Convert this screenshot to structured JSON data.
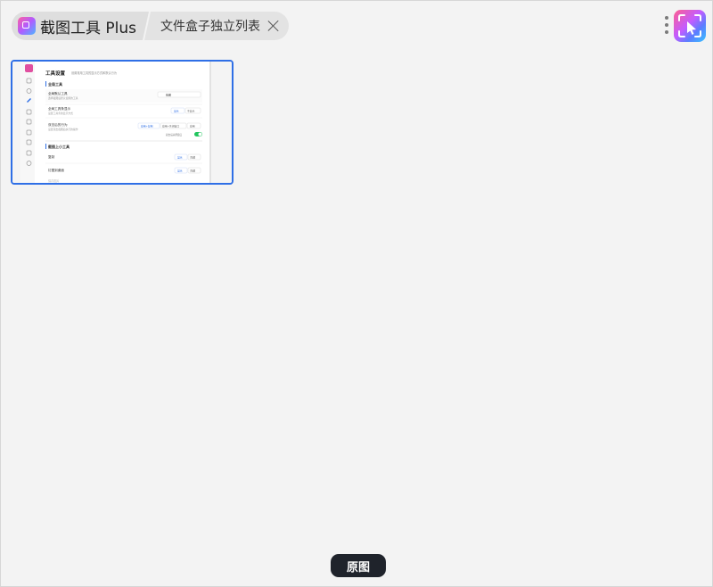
{
  "header": {
    "app_title": "截图工具 Plus",
    "tab_label": "文件盒子独立列表"
  },
  "icons": {
    "app_logo": "app-logo-icon",
    "close": "close-icon",
    "menu": "more-vertical-icon",
    "brand": "brand-logo-icon"
  },
  "thumbnail": {
    "page_title": "工具设置",
    "page_subtitle": "设置常用工具的显示方式和默认行为",
    "section1": "全局工具",
    "row1_label": "全局默认工具",
    "row1_desc": "选择截图后默认使用的工具",
    "row1_value": "截图",
    "row2_label": "全局工具条显示",
    "row2_desc": "设置工具条的显示方式",
    "row2_opt1": "显示",
    "row2_opt2": "不显示",
    "row3_label": "双击后的行为",
    "row3_desc": "设置双击截图后执行的操作",
    "row3_opt1": "应用+复制",
    "row3_opt2": "应用+关闭窗口",
    "row3_opt3": "应用",
    "row3_toggle_label": "双击后关闭窗口",
    "section2": "截图上小工具",
    "row4_label": "复制",
    "row4_opt1": "显示",
    "row4_opt2": "隐藏",
    "row5_label": "钉图到桌面",
    "row5_opt1": "显示",
    "row5_opt2": "隐藏",
    "row6_label": "保存图片"
  },
  "colors": {
    "selection_border": "#2f6fe6",
    "button_dark": "#1f232b",
    "accent": "#2f6fe6",
    "toggle_on": "#22c55e"
  },
  "footer": {
    "original_label": "原图"
  }
}
